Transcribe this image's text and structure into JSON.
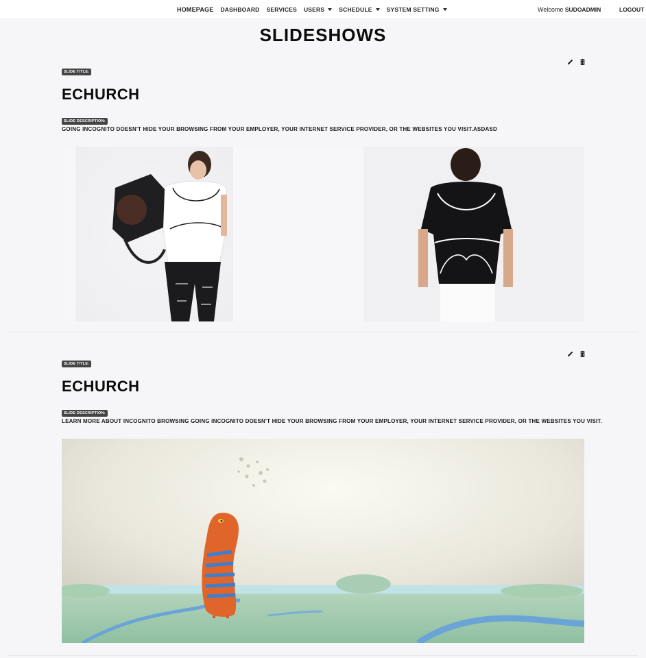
{
  "nav": {
    "items": [
      {
        "label": "Homepage",
        "dropdown": false
      },
      {
        "label": "Dashboard",
        "dropdown": false
      },
      {
        "label": "Services",
        "dropdown": false
      },
      {
        "label": "Users",
        "dropdown": true
      },
      {
        "label": "Schedule",
        "dropdown": true
      },
      {
        "label": "System Setting",
        "dropdown": true
      }
    ],
    "welcome_prefix": "Welcome",
    "username": "SUDOADMIN",
    "logout": "LOGOUT"
  },
  "page": {
    "title": "SLIDESHOWS"
  },
  "slides": [
    {
      "title_tag": "SLIDE TITLE:",
      "title": "ECHURCH",
      "desc_tag": "SLIDE DESCRIPTION:",
      "description": "Going Incognito doesn't hide your browsing from your employer, your internet service provider, or the websites you visit.asdasd",
      "image": "fashion-models-tshirt-photo"
    },
    {
      "title_tag": "SLIDE TITLE:",
      "title": "ECHURCH",
      "desc_tag": "SLIDE DESCRIPTION:",
      "description": "Learn more about Incognito browsing Going Incognito doesn't hide your browsing from your employer, your internet service provider, or the websites you visit.",
      "image": "cartoon-creature-landscape-illustration"
    }
  ],
  "icons": {
    "edit": "pencil-icon",
    "delete": "trash-icon",
    "dropdown": "caret-down-icon"
  }
}
